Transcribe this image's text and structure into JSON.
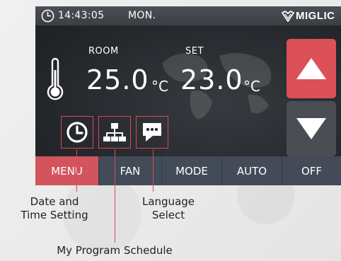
{
  "status_bar": {
    "time": "14:43:05",
    "day": "MON.",
    "brand": "MIGLIC"
  },
  "readings": {
    "room_label": "ROOM",
    "room_value": "25.0",
    "set_label": "SET",
    "set_value": "23.0",
    "unit": "°C"
  },
  "icons": {
    "clock": "clock-icon",
    "thermometer": "thermometer-icon",
    "schedule": "sitemap-icon",
    "language": "chat-bubble-icon",
    "up": "triangle-up-icon",
    "down": "triangle-down-icon"
  },
  "menu": {
    "items": [
      {
        "label": "MENU",
        "active": true
      },
      {
        "label": "FAN",
        "active": false
      },
      {
        "label": "MODE",
        "active": false
      },
      {
        "label": "AUTO",
        "active": false
      },
      {
        "label": "OFF",
        "active": false
      }
    ]
  },
  "callouts": {
    "date_time": "Date and\nTime Setting",
    "language": "Language\nSelect",
    "program": "My Program Schedule"
  },
  "colors": {
    "accent": "#d3545c",
    "screen_bg": "#25282c",
    "menu_bg": "#434a58",
    "arrow_down_bg": "#4a4e54"
  }
}
